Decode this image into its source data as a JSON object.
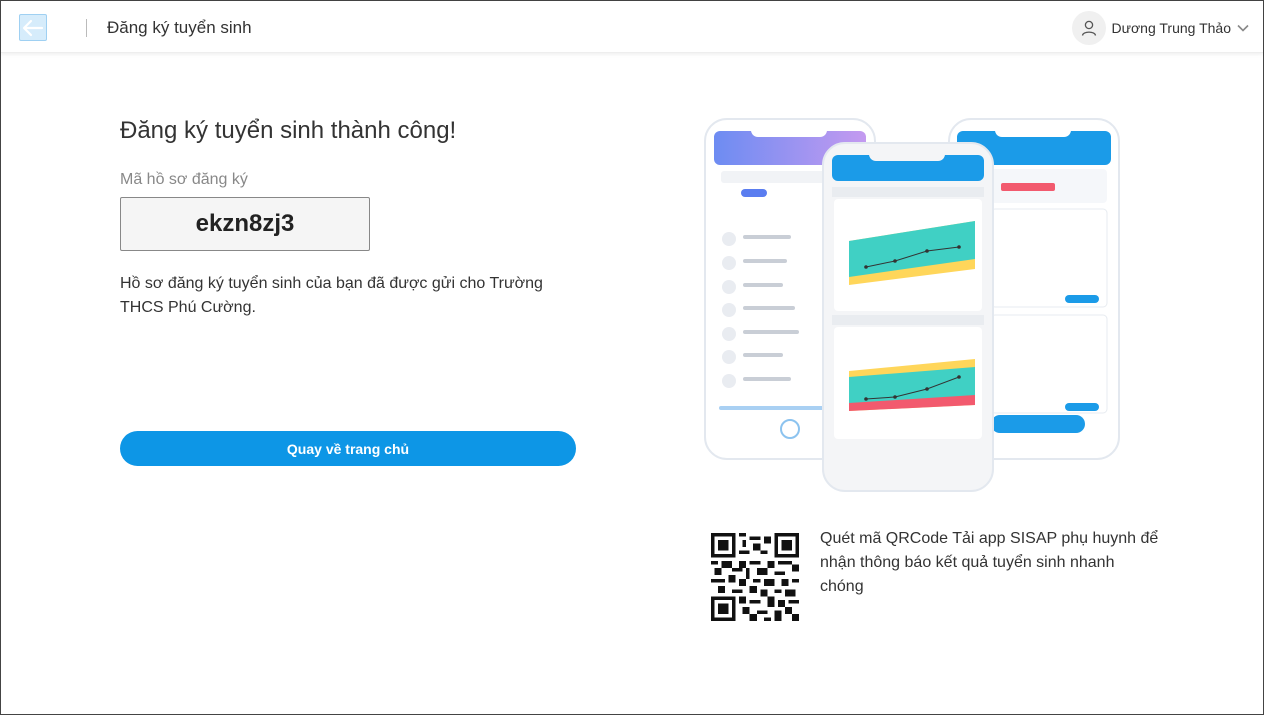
{
  "header": {
    "title": "Đăng ký tuyển sinh",
    "user_name": "Dương Trung Thảo"
  },
  "main": {
    "success_title": "Đăng ký tuyển sinh thành công!",
    "code_label": "Mã hồ sơ đăng ký",
    "code_value": "ekzn8zj3",
    "description": "Hồ sơ đăng ký tuyển sinh của bạn đã được gửi cho Trường THCS Phú Cường.",
    "home_button": "Quay về trang chủ"
  },
  "promo": {
    "qr_text": "Quét mã QRCode Tải app SISAP phụ huynh để nhận thông báo kết quả tuyển sinh nhanh chóng"
  },
  "colors": {
    "accent": "#0d96e6",
    "mock_blue": "#1b9be8",
    "mock_green": "#40d0c4",
    "mock_yellow": "#ffd65a",
    "mock_red": "#f25a6e"
  }
}
